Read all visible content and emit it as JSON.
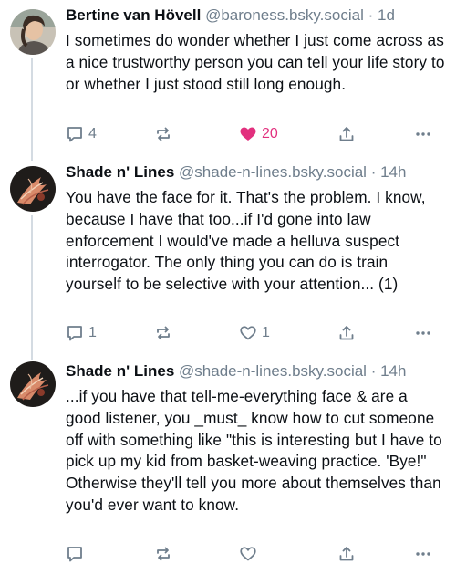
{
  "posts": [
    {
      "display_name": "Bertine van Hövell",
      "handle": "@baroness.bsky.social",
      "separator": "·",
      "time": "1d",
      "text": "I sometimes do wonder whether I just come across as a nice trustworthy person you can tell your life story to or whether I just stood still long enough.",
      "reply_count": "4",
      "repost_count": "",
      "like_count": "20",
      "liked": true,
      "avatar_icon": "person-photo"
    },
    {
      "display_name": "Shade n' Lines",
      "handle": "@shade-n-lines.bsky.social",
      "separator": "·",
      "time": "14h",
      "text": "You have the face for it. That's the problem. I know, because I have that too...if I'd gone into law enforcement I would've made a helluva suspect interrogator. The only thing you can do is train yourself to be selective with your attention... (1)",
      "reply_count": "1",
      "repost_count": "",
      "like_count": "1",
      "liked": false,
      "avatar_icon": "ink-artwork"
    },
    {
      "display_name": "Shade n' Lines",
      "handle": "@shade-n-lines.bsky.social",
      "separator": "·",
      "time": "14h",
      "text": "...if you have that tell-me-everything face & are a good listener, you _must_ know how to cut someone off with something like \"this is interesting but I have to pick up my kid from basket-weaving practice. 'Bye!\" Otherwise they'll tell you more about themselves than you'd ever want to know.",
      "reply_count": "",
      "repost_count": "",
      "like_count": "",
      "liked": false,
      "avatar_icon": "ink-artwork"
    }
  ],
  "colors": {
    "text": "#0b0f14",
    "muted": "#6f7e8c",
    "like": "#e2307e",
    "thread_line": "#d4dbe2"
  }
}
